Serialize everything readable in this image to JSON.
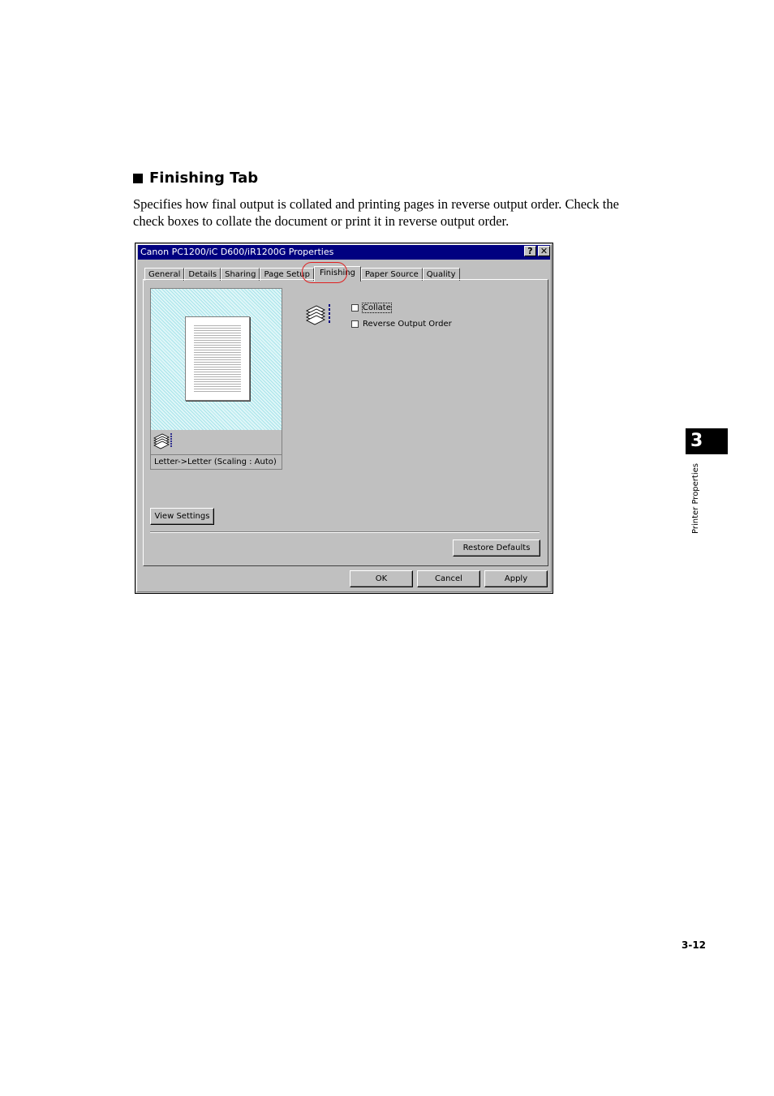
{
  "section": {
    "heading": "Finishing Tab",
    "body_lines": [
      "Specifies how final output is collated and printing pages in reverse output order. Check the",
      "check boxes to collate the document or print it in reverse output order."
    ]
  },
  "dialog": {
    "title": "Canon PC1200/iC D600/iR1200G Properties",
    "help_button": "?",
    "close_button": "✕",
    "tabs": [
      "General",
      "Details",
      "Sharing",
      "Page Setup",
      "Finishing",
      "Paper Source",
      "Quality"
    ],
    "active_tab": "Finishing",
    "preview_caption": "Letter->Letter (Scaling : Auto)",
    "options": {
      "collate": {
        "label": "Collate",
        "checked": false
      },
      "reverse_output": {
        "label": "Reverse Output Order",
        "checked": false
      }
    },
    "buttons": {
      "view_settings": "View Settings",
      "restore_defaults": "Restore Defaults",
      "ok": "OK",
      "cancel": "Cancel",
      "apply": "Apply"
    }
  },
  "sidebar": {
    "chapter_number": "3",
    "chapter_label": "Printer Properties"
  },
  "footer": {
    "page_number": "3-12"
  },
  "colors": {
    "titlebar": "#000080",
    "dialog_face": "#c0c0c0",
    "highlight_ring": "#e02020",
    "preview_pattern": "#a8e4ea"
  }
}
